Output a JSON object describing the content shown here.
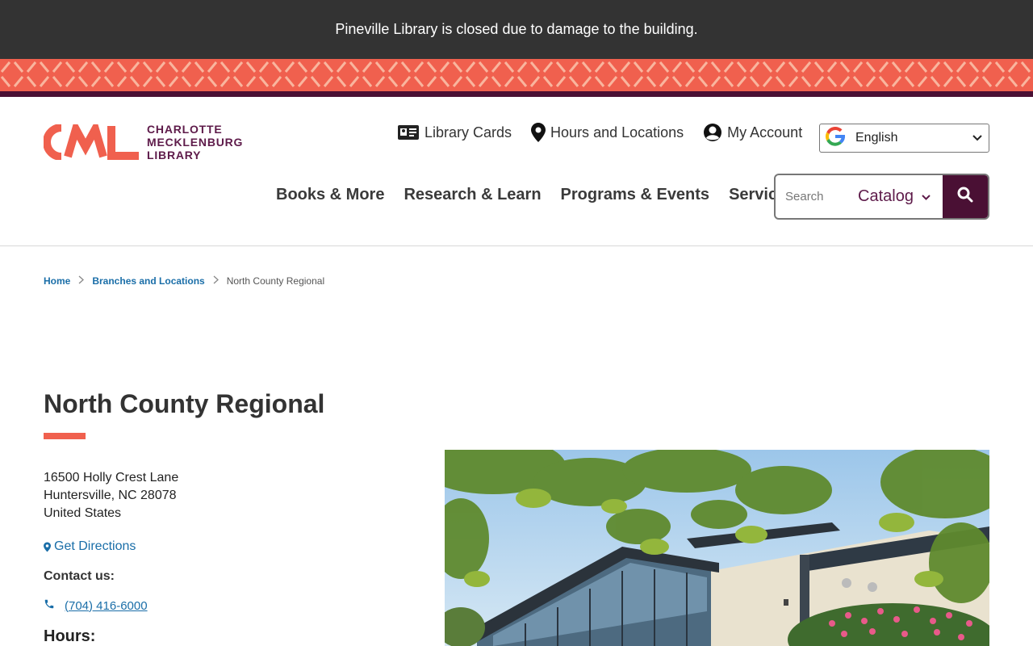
{
  "alert": {
    "message": "Pineville Library is closed due to damage to the building."
  },
  "colors": {
    "coral": "#f0604e",
    "maroon": "#4a1034",
    "plum": "#5e1b4a",
    "link": "#1a6ea8",
    "alert_bg": "#333333"
  },
  "logo": {
    "mark": "CML",
    "line1": "CHARLOTTE",
    "line2": "MECKLENBURG",
    "line3": "LIBRARY"
  },
  "utility_nav": [
    {
      "label": "Library Cards",
      "icon": "id-card-icon"
    },
    {
      "label": "Hours and Locations",
      "icon": "map-marker-icon"
    },
    {
      "label": "My Account",
      "icon": "user-circle-icon"
    }
  ],
  "language": {
    "selected": "English",
    "icon": "google-icon"
  },
  "main_nav": [
    "Books & More",
    "Research & Learn",
    "Programs & Events",
    "Services"
  ],
  "search": {
    "placeholder": "Search",
    "scope": "Catalog",
    "icon": "search-icon"
  },
  "breadcrumb": {
    "home": "Home",
    "branches": "Branches and Locations",
    "current": "North County Regional"
  },
  "branch": {
    "title": "North County Regional",
    "address_line1": "16500 Holly Crest Lane",
    "address_line2": "Huntersville, NC 28078",
    "address_line3": "United States",
    "directions": "Get Directions",
    "contact_label": "Contact us:",
    "phone": "(704) 416-6000",
    "hours_label": "Hours:"
  }
}
